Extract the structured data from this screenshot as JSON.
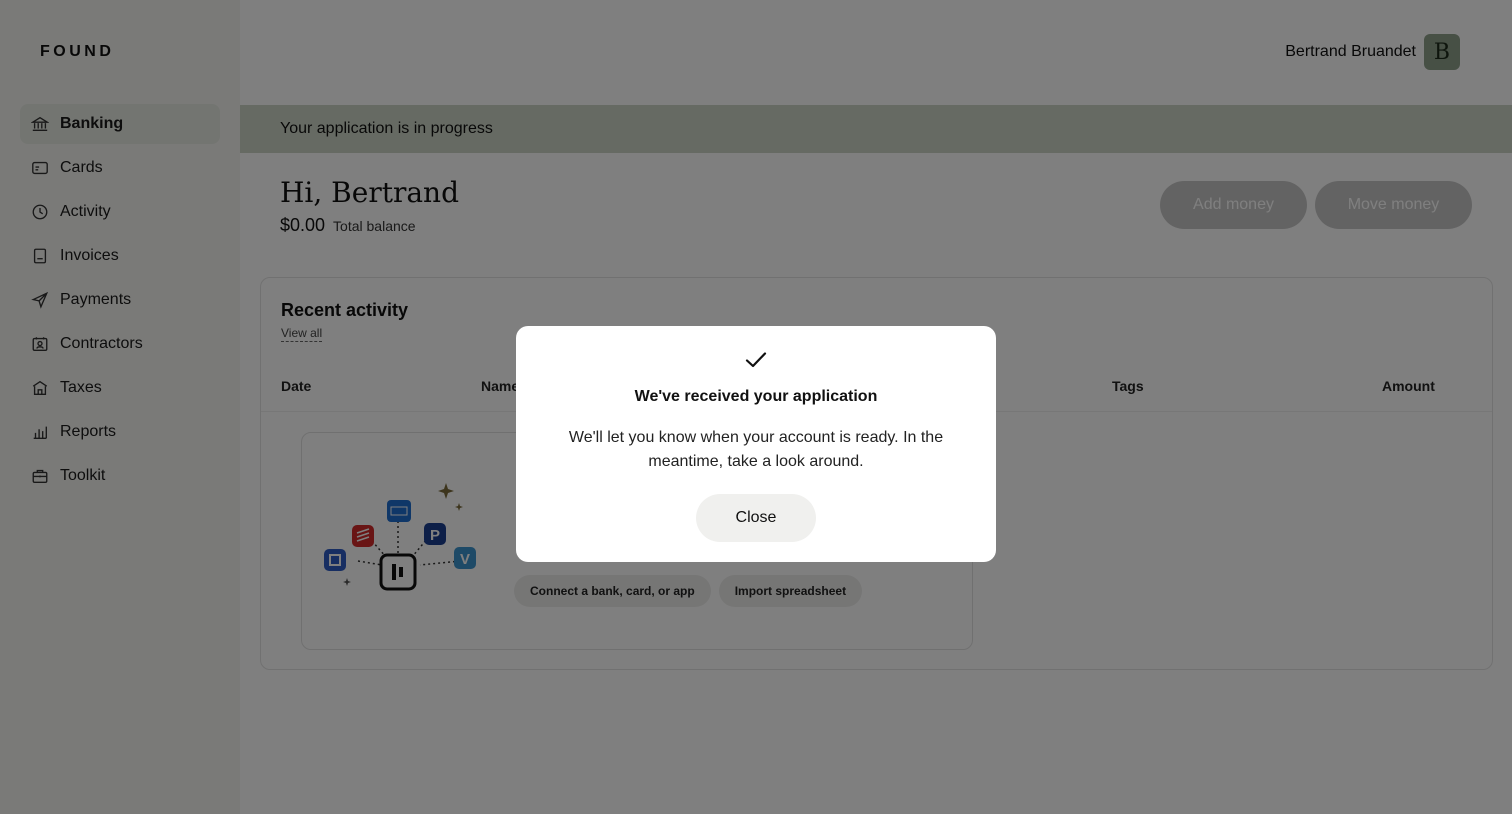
{
  "brand": {
    "logo": "FOUND"
  },
  "user": {
    "name": "Bertrand Bruandet",
    "initial": "B"
  },
  "sidebar": {
    "items": [
      {
        "label": "Banking",
        "icon": "bank-icon",
        "active": true
      },
      {
        "label": "Cards",
        "icon": "card-icon"
      },
      {
        "label": "Activity",
        "icon": "clock-icon"
      },
      {
        "label": "Invoices",
        "icon": "invoice-icon"
      },
      {
        "label": "Payments",
        "icon": "send-icon"
      },
      {
        "label": "Contractors",
        "icon": "contractor-icon"
      },
      {
        "label": "Taxes",
        "icon": "building-icon"
      },
      {
        "label": "Reports",
        "icon": "bar-chart-icon"
      },
      {
        "label": "Toolkit",
        "icon": "briefcase-icon"
      }
    ]
  },
  "banner": {
    "text": "Your application is in progress"
  },
  "header": {
    "greeting": "Hi, Bertrand",
    "balance_amount": "$0.00",
    "balance_label": "Total balance",
    "add_money": "Add money",
    "move_money": "Move money"
  },
  "activity": {
    "title": "Recent activity",
    "view_all": "View all",
    "columns": {
      "date": "Date",
      "name": "Name",
      "tags": "Tags",
      "amount": "Amount"
    },
    "empty_actions": {
      "connect": "Connect a bank, card, or app",
      "import": "Import spreadsheet"
    }
  },
  "modal": {
    "icon": "checkmark-icon",
    "title": "We've received your application",
    "body": "We'll let you know when your account is ready. In the meantime, take a look around.",
    "close": "Close"
  },
  "colors": {
    "accent": "#8fa08a",
    "banner": "#cdd5c6",
    "sidebar_bg": "#f4f4f1"
  }
}
